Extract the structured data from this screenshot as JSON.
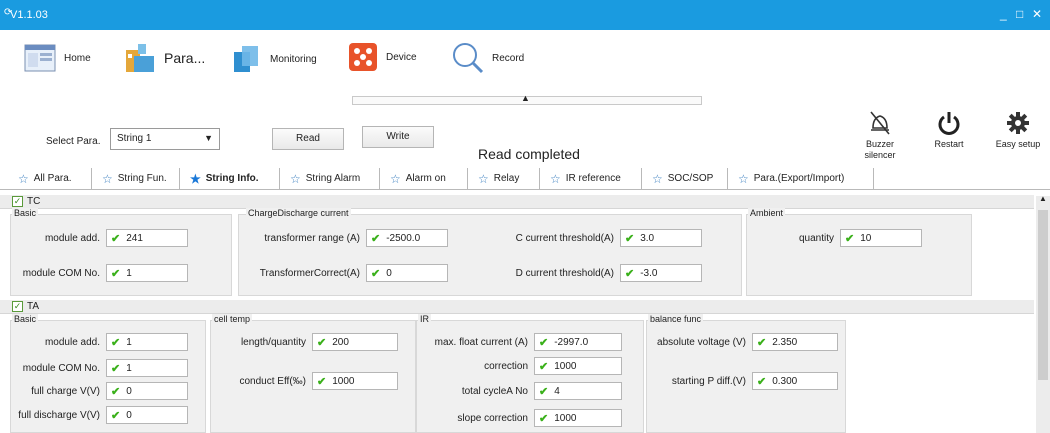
{
  "window": {
    "title": "V1.1.03",
    "minimize": "_",
    "maximize": "□",
    "close": "✕"
  },
  "nav": {
    "home": "Home",
    "para": "Para...",
    "monitoring": "Monitoring",
    "device": "Device",
    "record": "Record"
  },
  "controls": {
    "select_label": "Select Para.",
    "select_value": "String 1",
    "read": "Read",
    "write": "Write",
    "status": "Read completed"
  },
  "actions": {
    "buzzer": "Buzzer silencer",
    "restart": "Restart",
    "easy_setup": "Easy setup"
  },
  "tabs": [
    "All Para.",
    "String Fun.",
    "String Info.",
    "String Alarm",
    "Alarm on",
    "Relay",
    "IR reference",
    "SOC/SOP",
    "Para.(Export/Import)"
  ],
  "tc": {
    "name": "TC",
    "basic": {
      "title": "Basic",
      "module_addr_label": "module add.",
      "module_addr": "241",
      "module_com_label": "module COM No.",
      "module_com": "1"
    },
    "charge": {
      "title": "ChargeDischarge current",
      "transformer_range_label": "transformer range (A)",
      "transformer_range": "-2500.0",
      "transformer_correct_label": "TransformerCorrect(A)",
      "transformer_correct": "0",
      "c_threshold_label": "C current threshold(A)",
      "c_threshold": "3.0",
      "d_threshold_label": "D current threshold(A)",
      "d_threshold": "-3.0"
    },
    "ambient": {
      "title": "Ambient",
      "quantity_label": "quantity",
      "quantity": "10"
    }
  },
  "ta": {
    "name": "TA",
    "basic": {
      "title": "Basic",
      "module_addr_label": "module add.",
      "module_addr": "1",
      "module_com_label": "module COM No.",
      "module_com": "1",
      "full_charge_label": "full charge V(V)",
      "full_charge": "0",
      "full_discharge_label": "full discharge V(V)",
      "full_discharge": "0"
    },
    "cell_temp": {
      "title": "cell temp",
      "length_label": "length/quantity",
      "length": "200",
      "conduct_label": "conduct Eff(‰)",
      "conduct": "1000"
    },
    "ir": {
      "title": "IR",
      "max_float_label": "max. float current (A)",
      "max_float": "-2997.0",
      "correction_label": "correction",
      "correction": "1000",
      "total_cycle_label": "total cycleA No",
      "total_cycle": "4",
      "slope_label": "slope correction",
      "slope": "1000"
    },
    "balance": {
      "title": "balance func",
      "abs_voltage_label": "absolute voltage (V)",
      "abs_voltage": "2.350",
      "starting_p_label": "starting P diff.(V)",
      "starting_p": "0.300"
    }
  }
}
